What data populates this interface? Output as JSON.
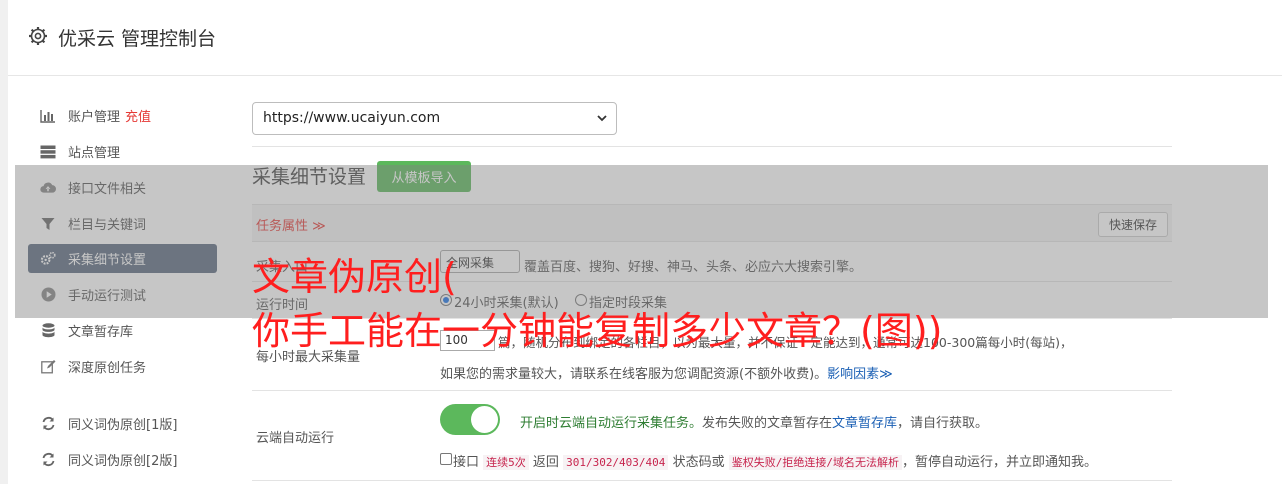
{
  "header": {
    "title": "优采云 管理控制台"
  },
  "sidebar": {
    "items": [
      {
        "label": "账户管理",
        "extra": "充值"
      },
      {
        "label": "站点管理"
      },
      {
        "label": "接口文件相关"
      },
      {
        "label": "栏目与关键词"
      },
      {
        "label": "采集细节设置"
      },
      {
        "label": "手动运行测试"
      },
      {
        "label": "文章暂存库"
      },
      {
        "label": "深度原创任务"
      },
      {
        "label": "同义词伪原创[1版]"
      },
      {
        "label": "同义词伪原创[2版]"
      }
    ]
  },
  "main": {
    "site_select": "https://www.ucaiyun.com",
    "section_title": "采集细节设置",
    "template_button": "从模板导入",
    "task_attr_label": "任务属性 ≫",
    "quick_save": "快速保存",
    "source": {
      "label": "采集入口",
      "select_value": "全网采集",
      "desc": "覆盖百度、搜狗、好搜、神马、头条、必应六大搜索引擎。"
    },
    "run_time": {
      "label": "运行时间",
      "opt1": "24小时采集(默认)",
      "opt2": "指定时段采集"
    },
    "max_per_hour": {
      "label": "每小时最大采集量",
      "value": "100",
      "line1a": "篇，随机分布到绑定的各栏目，以为最大量，并不保证一定能达到，通常可达100-300篇每小时(每站)，",
      "line2": "如果您的需求量较大，请联系在线客服为您调配资源(不额外收费)。",
      "link": "影响因素≫"
    },
    "cloud_auto": {
      "label": "云端自动运行",
      "desc_green": "开启时云端自动运行采集任务。",
      "desc_mid": "发布失败的文章暂存在",
      "desc_link": "文章暂存库",
      "desc_tail": "，请自行获取。",
      "chk_text1": "接口",
      "chk_code1": "连续5次",
      "chk_text2": "返回",
      "chk_code2": "301/302/403/404",
      "chk_text3": "状态码或",
      "chk_code3": "鉴权失败/拒绝连接/域名无法解析",
      "chk_text4": "，暂停自动运行，并立即通知我。"
    }
  },
  "overlay": {
    "line1": "文章伪原创(",
    "line2": "你手工能在一分钟能复制多少文章？(图))"
  },
  "colors": {
    "accent_green": "#5cb85c",
    "active_nav": "#5c6b80",
    "overlay_text": "#ff1e1e"
  }
}
